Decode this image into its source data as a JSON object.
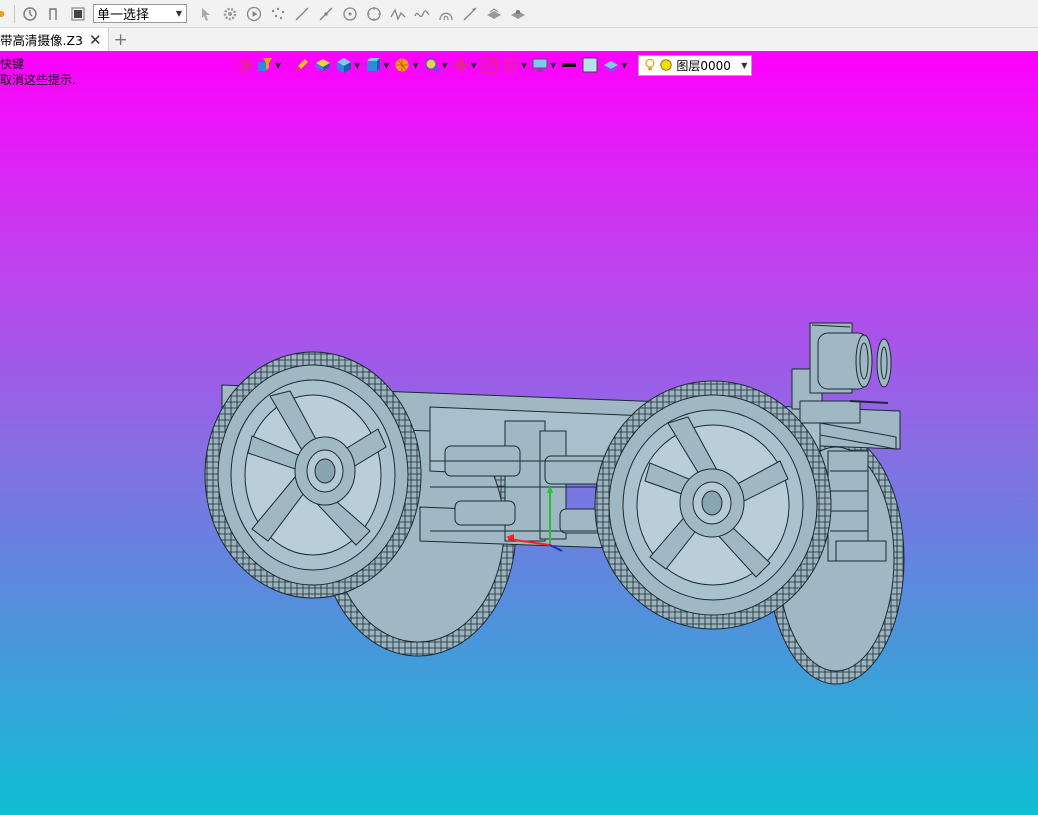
{
  "toolbar": {
    "filter_select": "单一选择"
  },
  "tabs": [
    {
      "label": "带高清摄像.Z3"
    }
  ],
  "hints": [
    {
      "text": "快键"
    },
    {
      "text": "取消这些提示."
    }
  ],
  "view_toolbar": {
    "layer_value": "图层0000"
  },
  "colors": {
    "gradient_top": "#fe00fe",
    "gradient_bottom": "#0fbfd5",
    "model_fill": "#9fb8c4",
    "model_edge": "#1c2a30"
  }
}
